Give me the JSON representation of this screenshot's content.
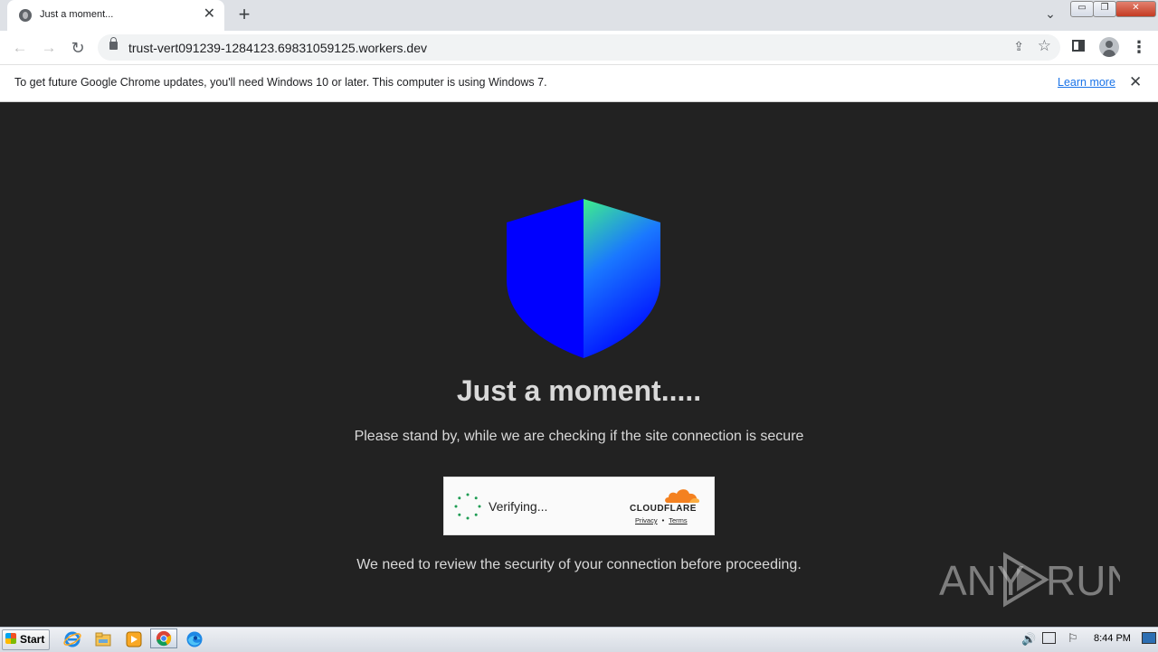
{
  "browser": {
    "tab_title": "Just a moment...",
    "tab_close": "✕",
    "new_tab": "+",
    "tab_search": "⌄",
    "window_min": "▭",
    "window_max": "❐",
    "window_close": "✕",
    "back": "←",
    "forward": "→",
    "reload": "↻",
    "url": "trust-vert091239-1284123.69831059125.workers.dev",
    "share": "⇪",
    "bookmark": "☆",
    "menu": "⋮"
  },
  "infobar": {
    "message": "To get future Google Chrome updates, you'll need Windows 10 or later. This computer is using Windows 7.",
    "learn_more": "Learn more",
    "close": "✕"
  },
  "page": {
    "heading": "Just a moment.....",
    "standby": "Please stand by, while we are checking if the site connection is secure",
    "widget": {
      "status": "Verifying...",
      "brand": "CLOUDFLARE",
      "privacy": "Privacy",
      "separator": "•",
      "terms": "Terms"
    },
    "review": "We need to review the security of your connection before proceeding."
  },
  "watermark": "ANY RUN",
  "taskbar": {
    "start": "Start",
    "speaker": "🔊",
    "flag": "⚐",
    "clock": "8:44 PM"
  },
  "colors": {
    "page_bg": "#222222",
    "shield_left": "#0000ff",
    "shield_right_top": "#3ef08a",
    "cloudflare_orange": "#f48120",
    "link": "#1a73e8"
  },
  "icons": {
    "tab_favicon": "globe-icon",
    "lock": "lock-icon",
    "shield": "shield-icon",
    "spinner": "spinner-icon",
    "cloudflare": "cloudflare-cloud-icon"
  }
}
